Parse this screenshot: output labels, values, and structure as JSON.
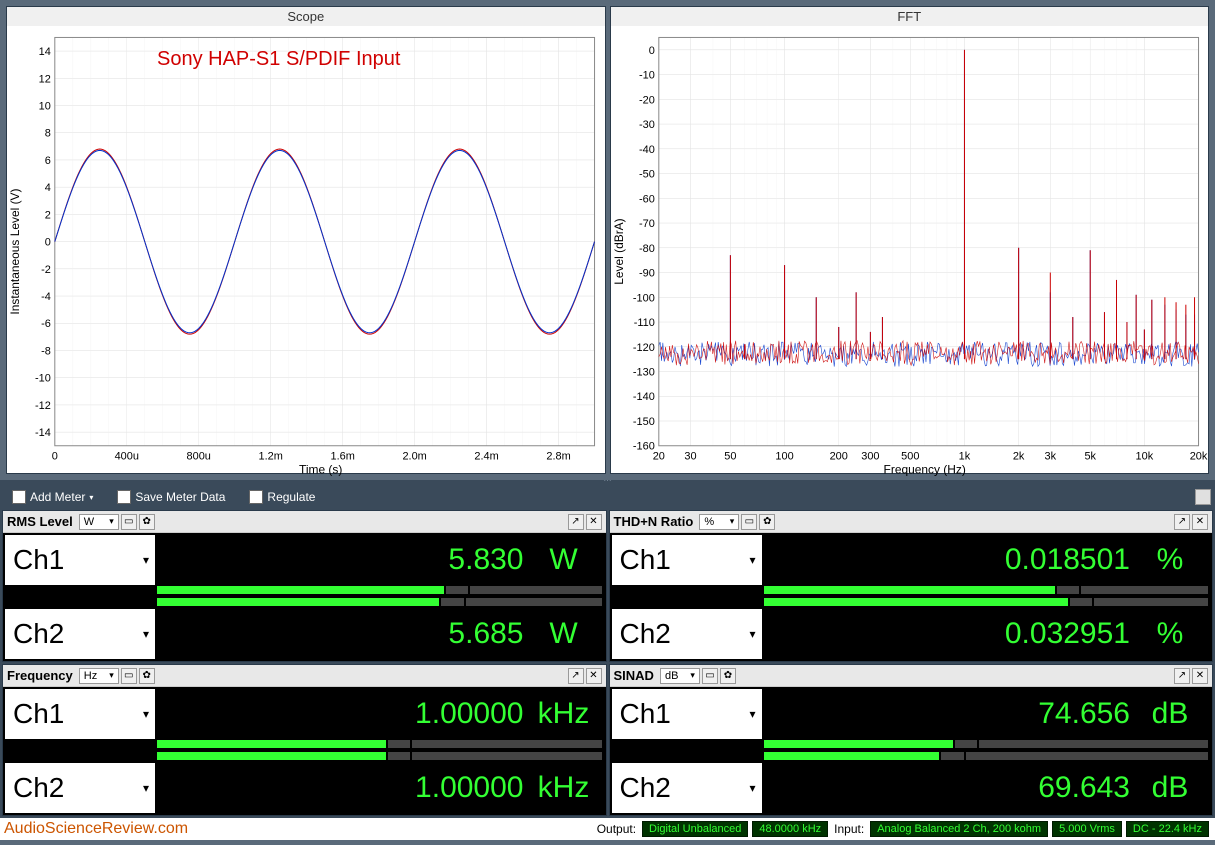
{
  "chart_data": [
    {
      "type": "line",
      "title": "Scope",
      "xlabel": "Time (s)",
      "ylabel": "Instantaneous Level (V)",
      "xticks": [
        "0",
        "400u",
        "800u",
        "1.2m",
        "1.6m",
        "2.0m",
        "2.4m",
        "2.8m"
      ],
      "yticks": [
        -14,
        -12,
        -10,
        -8,
        -6,
        -4,
        -2,
        0,
        2,
        4,
        6,
        8,
        10,
        12,
        14
      ],
      "xlim": [
        0,
        0.003
      ],
      "ylim": [
        -15,
        15
      ],
      "series": [
        {
          "name": "Ch1",
          "color": "#cc0000",
          "amplitude": 6.8,
          "frequency_hz": 1000,
          "waveform": "sine"
        },
        {
          "name": "Ch2",
          "color": "#0033cc",
          "amplitude": 6.7,
          "frequency_hz": 1000,
          "waveform": "sine"
        }
      ],
      "annotation": "Sony HAP-S1 S/PDIF Input"
    },
    {
      "type": "line",
      "title": "FFT",
      "xlabel": "Frequency (Hz)",
      "ylabel": "Level (dBrA)",
      "xscale": "log",
      "xticks": [
        "20",
        "30",
        "50",
        "100",
        "200",
        "300",
        "500",
        "1k",
        "2k",
        "3k",
        "5k",
        "10k",
        "20k"
      ],
      "yticks": [
        -160,
        -150,
        -140,
        -130,
        -120,
        -110,
        -100,
        -90,
        -80,
        -70,
        -60,
        -50,
        -40,
        -30,
        -20,
        -10,
        0
      ],
      "xlim": [
        20,
        20000
      ],
      "ylim": [
        -160,
        5
      ],
      "noise_floor_db": -125,
      "series": [
        {
          "name": "Ch1",
          "color": "#0033cc",
          "peaks": [
            {
              "hz": 50,
              "db": -83
            },
            {
              "hz": 60,
              "db": -119
            },
            {
              "hz": 100,
              "db": -87
            },
            {
              "hz": 150,
              "db": -100
            },
            {
              "hz": 200,
              "db": -112
            },
            {
              "hz": 250,
              "db": -98
            },
            {
              "hz": 300,
              "db": -114
            },
            {
              "hz": 350,
              "db": -108
            },
            {
              "hz": 1000,
              "db": 0
            },
            {
              "hz": 2000,
              "db": -80
            },
            {
              "hz": 3000,
              "db": -98
            },
            {
              "hz": 4000,
              "db": -108
            },
            {
              "hz": 5000,
              "db": -81
            },
            {
              "hz": 6000,
              "db": -106
            },
            {
              "hz": 7000,
              "db": -93
            },
            {
              "hz": 8000,
              "db": -110
            },
            {
              "hz": 9000,
              "db": -99
            },
            {
              "hz": 10000,
              "db": -113
            },
            {
              "hz": 11000,
              "db": -101
            },
            {
              "hz": 13000,
              "db": -103
            },
            {
              "hz": 15000,
              "db": -105
            },
            {
              "hz": 17000,
              "db": -107
            },
            {
              "hz": 19000,
              "db": -107
            }
          ]
        },
        {
          "name": "Ch2",
          "color": "#cc0000",
          "peaks": [
            {
              "hz": 50,
              "db": -83
            },
            {
              "hz": 60,
              "db": -119
            },
            {
              "hz": 100,
              "db": -87
            },
            {
              "hz": 150,
              "db": -100
            },
            {
              "hz": 200,
              "db": -112
            },
            {
              "hz": 250,
              "db": -98
            },
            {
              "hz": 300,
              "db": -114
            },
            {
              "hz": 350,
              "db": -108
            },
            {
              "hz": 1000,
              "db": 0
            },
            {
              "hz": 2000,
              "db": -80
            },
            {
              "hz": 3000,
              "db": -90
            },
            {
              "hz": 4000,
              "db": -108
            },
            {
              "hz": 5000,
              "db": -81
            },
            {
              "hz": 6000,
              "db": -106
            },
            {
              "hz": 7000,
              "db": -93
            },
            {
              "hz": 8000,
              "db": -110
            },
            {
              "hz": 9000,
              "db": -99
            },
            {
              "hz": 10000,
              "db": -113
            },
            {
              "hz": 11000,
              "db": -101
            },
            {
              "hz": 13000,
              "db": -100
            },
            {
              "hz": 15000,
              "db": -102
            },
            {
              "hz": 17000,
              "db": -103
            },
            {
              "hz": 19000,
              "db": -100
            }
          ]
        }
      ]
    }
  ],
  "scope": {
    "title": "Scope",
    "xlabel": "Time (s)",
    "ylabel": "Instantaneous Level (V)",
    "annotation": "Sony HAP-S1 S/PDIF Input"
  },
  "fft": {
    "title": "FFT",
    "xlabel": "Frequency (Hz)",
    "ylabel": "Level (dBrA)"
  },
  "toolbar": {
    "add_meter": "Add Meter",
    "save_meter": "Save Meter Data",
    "regulate": "Regulate"
  },
  "meters": {
    "rms": {
      "title": "RMS Level",
      "unit_selector": "W",
      "ch1_label": "Ch1",
      "ch1_value": "5.830",
      "ch1_unit": "W",
      "ch1_fill": 65,
      "ch2_label": "Ch2",
      "ch2_value": "5.685",
      "ch2_unit": "W",
      "ch2_fill": 64
    },
    "thdn": {
      "title": "THD+N Ratio",
      "unit_selector": "%",
      "ch1_label": "Ch1",
      "ch1_value": "0.018501",
      "ch1_unit": "%",
      "ch1_fill": 66,
      "ch2_label": "Ch2",
      "ch2_value": "0.032951",
      "ch2_unit": "%",
      "ch2_fill": 69
    },
    "freq": {
      "title": "Frequency",
      "unit_selector": "Hz",
      "ch1_label": "Ch1",
      "ch1_value": "1.00000",
      "ch1_unit": "kHz",
      "ch1_fill": 52,
      "ch2_label": "Ch2",
      "ch2_value": "1.00000",
      "ch2_unit": "kHz",
      "ch2_fill": 52
    },
    "sinad": {
      "title": "SINAD",
      "unit_selector": "dB",
      "ch1_label": "Ch1",
      "ch1_value": "74.656",
      "ch1_unit": "dB",
      "ch1_fill": 43,
      "ch2_label": "Ch2",
      "ch2_value": "69.643",
      "ch2_unit": "dB",
      "ch2_fill": 40
    }
  },
  "status": {
    "site": "AudioScienceReview.com",
    "output_label": "Output:",
    "output_mode": "Digital Unbalanced",
    "output_rate": "48.0000 kHz",
    "input_label": "Input:",
    "input_mode": "Analog Balanced 2 Ch, 200 kohm",
    "input_level": "5.000 Vrms",
    "input_bw": "DC - 22.4 kHz"
  }
}
